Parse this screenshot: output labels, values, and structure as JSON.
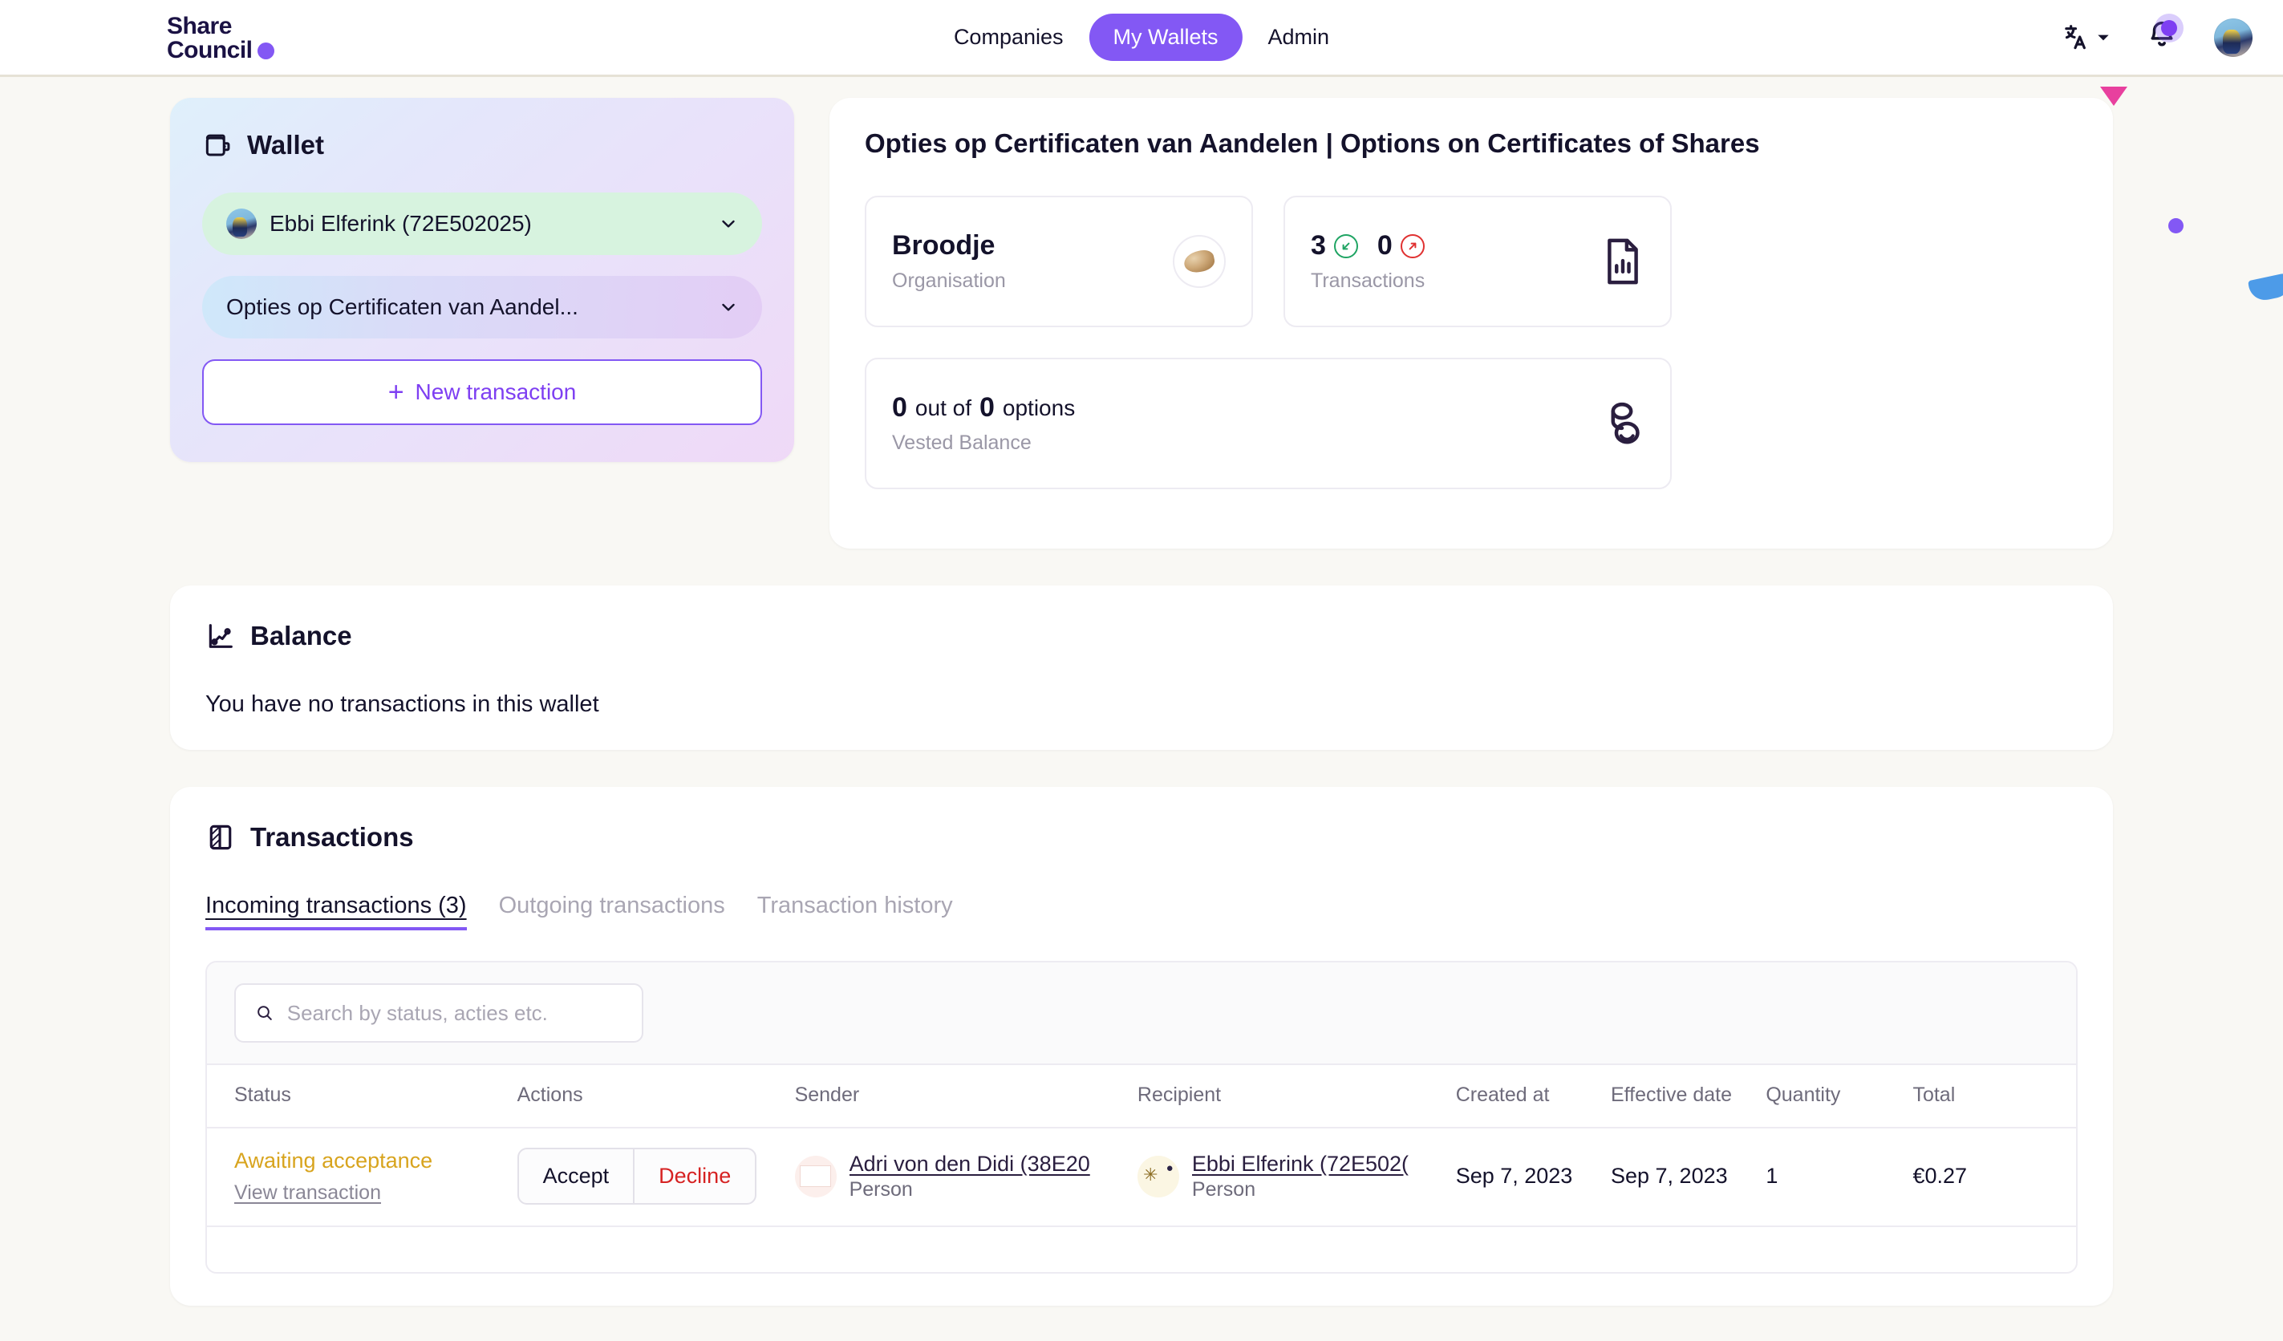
{
  "brand": {
    "name_line1": "Share",
    "name_line2": "Council",
    "accent": "#8358F4"
  },
  "header": {
    "nav": [
      {
        "label": "Companies",
        "active": false
      },
      {
        "label": "My Wallets",
        "active": true
      },
      {
        "label": "Admin",
        "active": false
      }
    ],
    "language_icon": "translate-icon",
    "notifications_icon": "bell-icon",
    "avatar_icon": "user-avatar"
  },
  "wallet_panel": {
    "title": "Wallet",
    "icon": "wallet-icon",
    "person_select": {
      "value": "Ebbi Elferink (72E502025)",
      "chevron": "chevron-down-icon"
    },
    "type_select": {
      "value": "Opties op Certificaten van Aandel...",
      "chevron": "chevron-down-icon"
    },
    "new_transaction_label": "New transaction",
    "new_transaction_plus": "+"
  },
  "detail_panel": {
    "title": "Opties op Certificaten van Aandelen | Options on Certificates of Shares",
    "cards": [
      {
        "value": "Broodje",
        "sub": "Organisation",
        "icon": "organisation-avatar"
      },
      {
        "incoming_count": "3",
        "outgoing_count": "0",
        "sub": "Transactions",
        "icon": "document-chart-icon"
      },
      {
        "vested_num": "0",
        "vested_mid": "out of",
        "vested_total": "0",
        "vested_unit": "options",
        "sub": "Vested Balance",
        "icon": "coins-icon"
      }
    ]
  },
  "balance_section": {
    "title": "Balance",
    "icon": "line-chart-icon",
    "empty_message": "You have no transactions in this wallet"
  },
  "transactions_section": {
    "title": "Transactions",
    "icon": "transactions-icon",
    "tabs": [
      {
        "label": "Incoming transactions (3)",
        "active": true
      },
      {
        "label": "Outgoing transactions",
        "active": false
      },
      {
        "label": "Transaction history",
        "active": false
      }
    ],
    "search": {
      "placeholder": "Search by status, acties etc.",
      "value": "",
      "icon": "search-icon"
    },
    "columns": [
      "Status",
      "Actions",
      "Sender",
      "Recipient",
      "Created at",
      "Effective date",
      "Quantity",
      "Total"
    ],
    "rows": [
      {
        "status": "Awaiting acceptance",
        "view_link": "View transaction",
        "accept_label": "Accept",
        "decline_label": "Decline",
        "sender_name": "Adri von den Didi (38E20",
        "sender_type": "Person",
        "recipient_name": "Ebbi Elferink (72E502(",
        "recipient_type": "Person",
        "created_at": "Sep 7, 2023",
        "effective_date": "Sep 7, 2023",
        "quantity": "1",
        "total": "€0.27"
      }
    ]
  },
  "decorations": {
    "triangle_color": "#E8409E",
    "circle_color": "#8358F4",
    "wedge_color": "#4D9BE8"
  }
}
